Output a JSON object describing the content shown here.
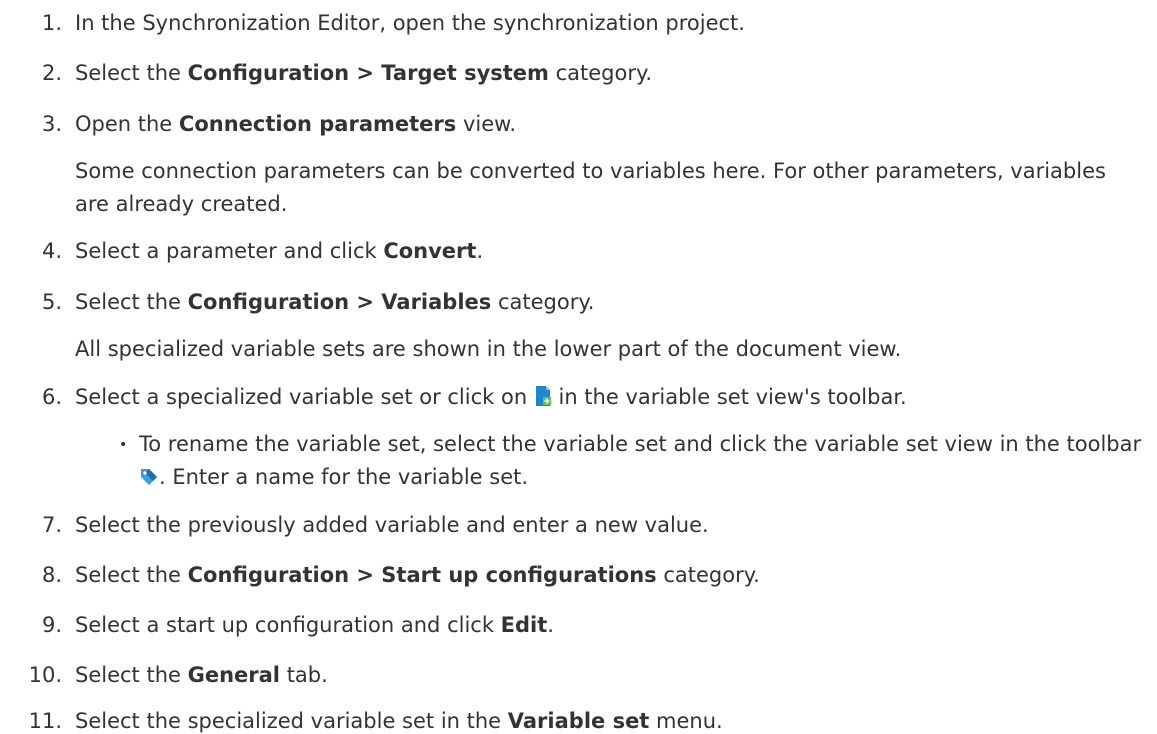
{
  "steps": [
    {
      "num": "1.",
      "parts": [
        "In the Synchronization Editor, open the synchronization project."
      ]
    },
    {
      "num": "2.",
      "pre": "Select the ",
      "bold": "Configuration > Target system",
      "post": " category."
    },
    {
      "num": "3.",
      "pre": "Open the ",
      "bold": "Connection parameters",
      "post": " view."
    },
    {
      "num": "4.",
      "pre": "Select a parameter and click ",
      "bold": "Convert",
      "post": "."
    },
    {
      "num": "5.",
      "pre": "Select the ",
      "bold": "Configuration > Variables",
      "post": " category."
    },
    {
      "num": "6.",
      "pre": "Select a specialized variable set or click on ",
      "post": " in the variable set view's toolbar."
    },
    {
      "num": "7.",
      "text": "Select the previously added variable and enter a new value."
    },
    {
      "num": "8.",
      "pre": "Select the ",
      "bold": "Configuration > Start up configurations",
      "post": " category."
    },
    {
      "num": "9.",
      "pre": "Select a start up configuration and click ",
      "bold": "Edit",
      "post": "."
    },
    {
      "num": "10.",
      "pre": "Select the ",
      "bold": "General",
      "post": " tab."
    },
    {
      "num": "11.",
      "pre": "Select the specialized variable set in the ",
      "bold": "Variable set",
      "post": " menu."
    }
  ],
  "step1_text": "In the Synchronization Editor, open the synchronization project.",
  "step3_note": "Some connection parameters can be converted to variables here. For other parameters, variables are already created.",
  "step5_note": "All specialized variable sets are shown in the lower part of the document view.",
  "step6_bullet": {
    "pre": "To rename the variable set, select the variable set and click the variable set view in the toolbar",
    "post": ". Enter a name for the variable set."
  },
  "icons": {
    "add_variable_set": "add-variable-set-icon",
    "rename_tag": "rename-tag-icon",
    "accent_blue": "#1e88c8"
  }
}
